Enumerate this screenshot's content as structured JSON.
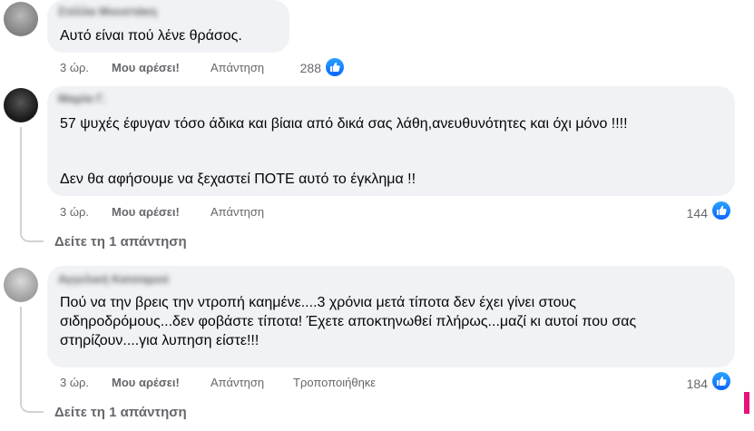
{
  "comments": [
    {
      "author": "Στέλλα Μουστάκη",
      "text": [
        "Αυτό είναι πού λένε θράσος."
      ],
      "time": "3 ώρ.",
      "like_label": "Μου αρέσει!",
      "reply_label": "Απάντηση",
      "reactions": "288"
    },
    {
      "author": "Μαρία Γ.",
      "text": [
        "57 ψυχές έφυγαν τόσο άδικα και βίαια από δικά σας λάθη,ανευθυνότητες και όχι μόνο !!!!",
        "Δεν θα αφήσουμε να ξεχαστεί ΠΟΤΕ αυτό το έγκλημα !!"
      ],
      "time": "3 ώρ.",
      "like_label": "Μου αρέσει!",
      "reply_label": "Απάντηση",
      "reactions": "144",
      "view_replies": "Δείτε τη 1 απάντηση"
    },
    {
      "author": "Αγγελική Κατσαρού",
      "text": [
        "Πού να την βρεις την ντροπή καημένε....3 χρόνια μετά τίποτα δεν έχει γίνει στους σιδηροδρόμους...δεν φοβάστε τίποτα! Έχετε αποκτηνωθεί πλήρως...μαζί κι αυτοί που σας στηρίζουν....για λυπηση είστε!!!"
      ],
      "time": "3 ώρ.",
      "like_label": "Μου αρέσει!",
      "reply_label": "Απάντηση",
      "edited_label": "Τροποποιήθηκε",
      "reactions": "184",
      "view_replies": "Δείτε τη 1 απάντηση"
    }
  ],
  "colors": {
    "bubble": "#f0f2f5",
    "meta_text": "#65676b",
    "like_blue": "#0866ff",
    "accent_pink": "#e5127d"
  },
  "icons": [
    "avatar",
    "like-reaction-icon",
    "thread-connector"
  ]
}
